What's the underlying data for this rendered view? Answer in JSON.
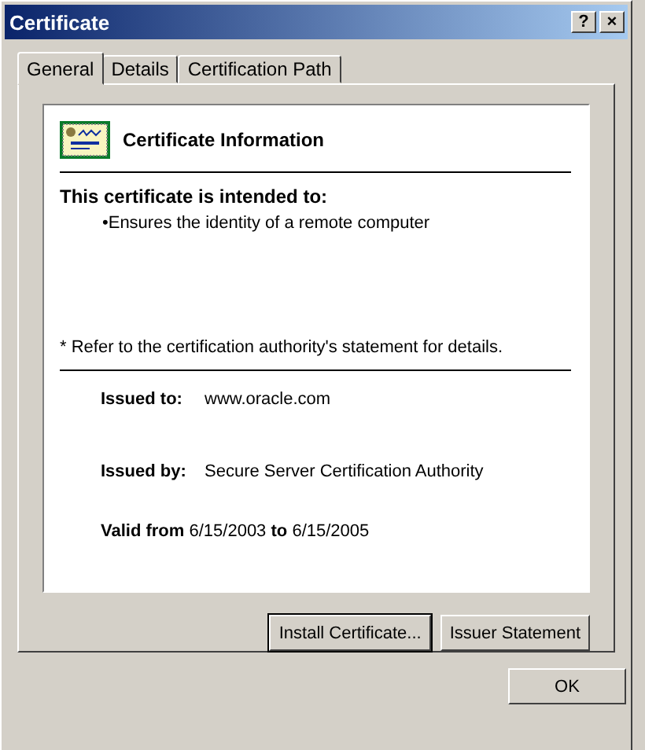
{
  "window": {
    "title": "Certificate",
    "title_buttons": [
      "?",
      "×"
    ]
  },
  "tabs": [
    {
      "label": "General",
      "selected": true
    },
    {
      "label": "Details",
      "selected": false
    },
    {
      "label": "Certification Path",
      "selected": false
    }
  ],
  "info": {
    "heading": "Certificate Information",
    "purpose_heading": "This certificate is intended to:",
    "purposes": [
      "•Ensures the identity of a remote computer"
    ],
    "note": "* Refer to the certification authority's statement for details.",
    "fields": [
      {
        "label": "Issued to:",
        "value": "www.oracle.com"
      },
      {
        "label": "Issued by:",
        "value": "Secure Server Certification Authority"
      }
    ],
    "validity": "**Valid from** 6/15/2003 **to** 6/15/2005"
  },
  "panel_buttons": [
    {
      "label": "Install Certificate...",
      "default": true
    },
    {
      "label": "Issuer Statement",
      "default": false
    }
  ],
  "dialog_buttons": [
    "OK"
  ]
}
